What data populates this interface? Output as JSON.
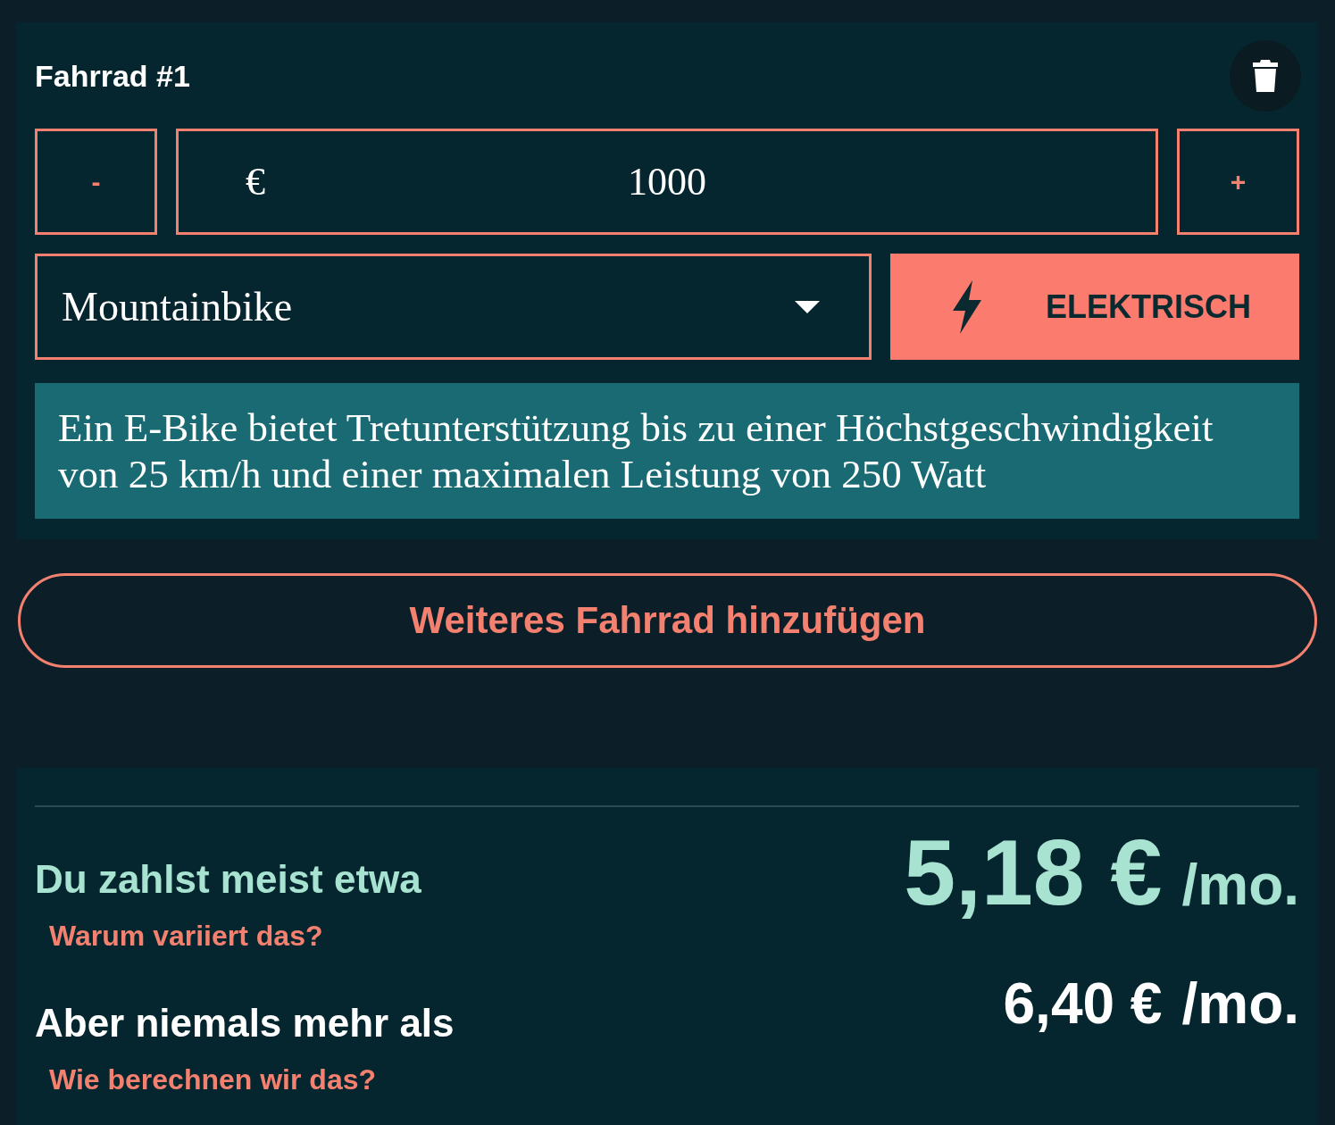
{
  "bike": {
    "title": "Fahrrad #1",
    "minus": "-",
    "plus": "+",
    "price": {
      "currency": "€",
      "value": "1000"
    },
    "type": {
      "value": "Mountainbike"
    },
    "electric": {
      "label": "ELEKTRISCH",
      "selected": true
    },
    "info": "Ein E-Bike bietet Tretunterstützung bis zu einer Höchstgeschwindigkeit von 25 km/h und einer maximalen Leistung von 250 Watt"
  },
  "add_button": "Weiteres Fahrrad hinzufügen",
  "summary": {
    "typical": {
      "label": "Du zahlst meist etwa",
      "amount": "5,18 €",
      "unit": "/mo.",
      "link": "Warum variiert das?"
    },
    "maximum": {
      "label": "Aber niemals mehr als",
      "amount": "6,40 €",
      "unit": "/mo.",
      "link": "Wie berechnen wir das?"
    }
  }
}
